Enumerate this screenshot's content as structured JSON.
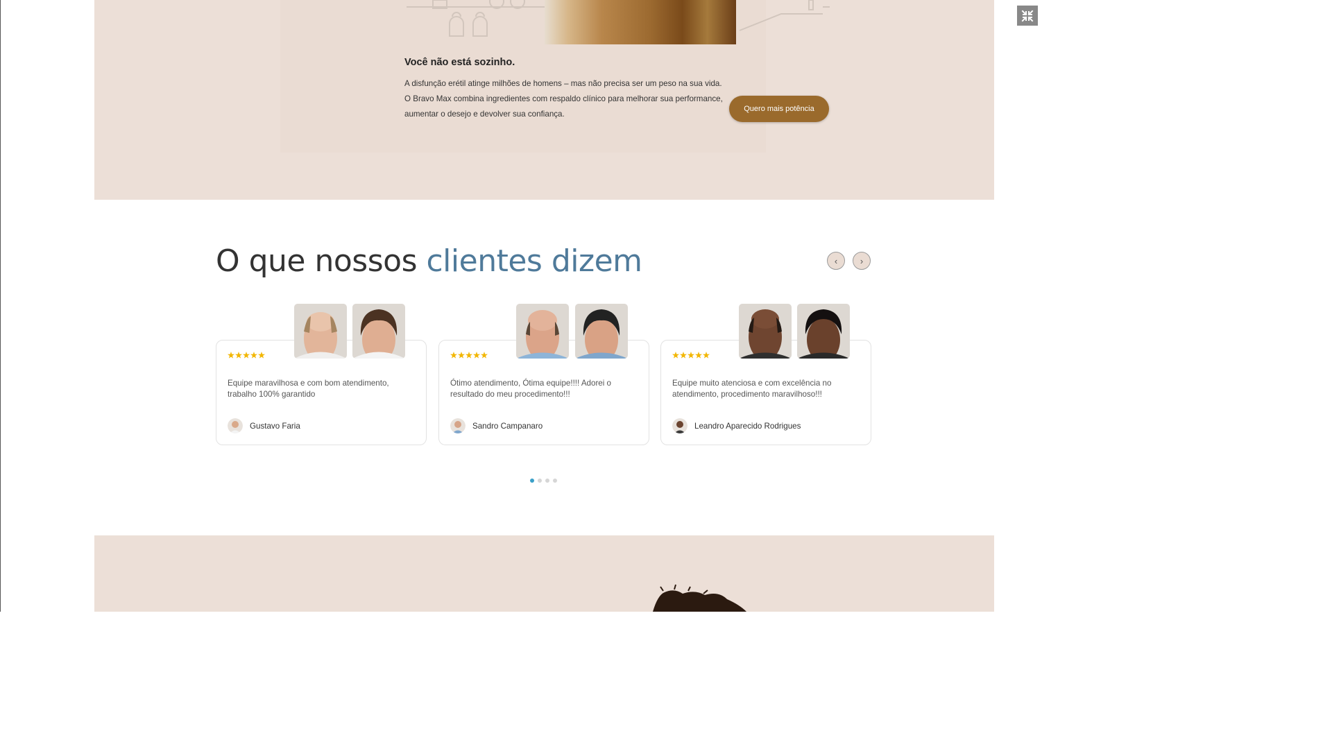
{
  "hero": {
    "title": "Você não está sozinho.",
    "body": "A disfunção erétil atinge milhões de homens – mas não precisa ser um peso na sua vida. O Bravo Max combina ingredientes com respaldo clínico para melhorar sua performance, aumentar o desejo e devolver sua confiança.",
    "cta_label": "Quero mais potência"
  },
  "testimonials": {
    "title_plain": "O que nossos ",
    "title_accent": "clientes dizem",
    "prev_label": "‹",
    "next_label": "›",
    "cards": [
      {
        "rating": 5,
        "text": "Equipe maravilhosa e com bom atendimento, trabalho 100% garantido",
        "author": "Gustavo Faria"
      },
      {
        "rating": 5,
        "text": "Ótimo atendimento, Ótima equipe!!!! Adorei o resultado do meu procedimento!!!",
        "author": "Sandro Campanaro"
      },
      {
        "rating": 5,
        "text": "Equipe muito atenciosa e com excelência no atendimento, procedimento maravilhoso!!!",
        "author": "Leandro Aparecido Rodrigues"
      }
    ],
    "pagination": {
      "pages": 4,
      "active": 1
    }
  },
  "colors": {
    "section_bg": "#ecdfd7",
    "accent_blue": "#4f7a9a",
    "cta_brown": "#9a6a2c",
    "star_gold": "#f2b705",
    "dot_active": "#3aa0c8"
  },
  "icons": {
    "fullscreen": "collapse-fullscreen-icon",
    "prev": "chevron-left-icon",
    "next": "chevron-right-icon",
    "rating": "star-icon"
  }
}
